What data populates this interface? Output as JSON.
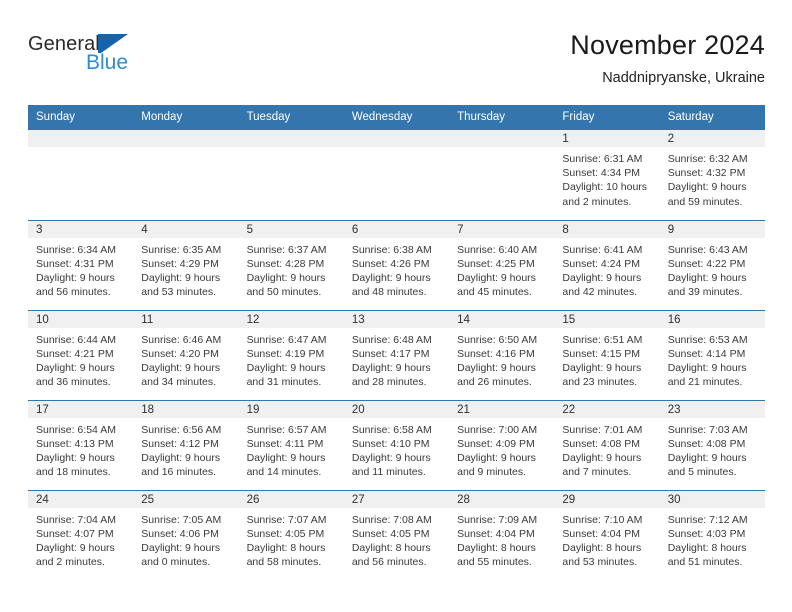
{
  "brand": {
    "name_part1": "General",
    "name_part2": "Blue",
    "logo_icon": "general-blue-triangle-logo",
    "accent_color": "#2e8bd6",
    "header_blue": "#3575ae"
  },
  "header": {
    "title": "November 2024",
    "location": "Naddnipryanske, Ukraine"
  },
  "calendar": {
    "weekday_headers": [
      "Sunday",
      "Monday",
      "Tuesday",
      "Wednesday",
      "Thursday",
      "Friday",
      "Saturday"
    ],
    "weeks": [
      [
        {
          "empty": true
        },
        {
          "empty": true
        },
        {
          "empty": true
        },
        {
          "empty": true
        },
        {
          "empty": true
        },
        {
          "day": "1",
          "sunrise": "Sunrise: 6:31 AM",
          "sunset": "Sunset: 4:34 PM",
          "daylight1": "Daylight: 10 hours",
          "daylight2": "and 2 minutes."
        },
        {
          "day": "2",
          "sunrise": "Sunrise: 6:32 AM",
          "sunset": "Sunset: 4:32 PM",
          "daylight1": "Daylight: 9 hours",
          "daylight2": "and 59 minutes."
        }
      ],
      [
        {
          "day": "3",
          "sunrise": "Sunrise: 6:34 AM",
          "sunset": "Sunset: 4:31 PM",
          "daylight1": "Daylight: 9 hours",
          "daylight2": "and 56 minutes."
        },
        {
          "day": "4",
          "sunrise": "Sunrise: 6:35 AM",
          "sunset": "Sunset: 4:29 PM",
          "daylight1": "Daylight: 9 hours",
          "daylight2": "and 53 minutes."
        },
        {
          "day": "5",
          "sunrise": "Sunrise: 6:37 AM",
          "sunset": "Sunset: 4:28 PM",
          "daylight1": "Daylight: 9 hours",
          "daylight2": "and 50 minutes."
        },
        {
          "day": "6",
          "sunrise": "Sunrise: 6:38 AM",
          "sunset": "Sunset: 4:26 PM",
          "daylight1": "Daylight: 9 hours",
          "daylight2": "and 48 minutes."
        },
        {
          "day": "7",
          "sunrise": "Sunrise: 6:40 AM",
          "sunset": "Sunset: 4:25 PM",
          "daylight1": "Daylight: 9 hours",
          "daylight2": "and 45 minutes."
        },
        {
          "day": "8",
          "sunrise": "Sunrise: 6:41 AM",
          "sunset": "Sunset: 4:24 PM",
          "daylight1": "Daylight: 9 hours",
          "daylight2": "and 42 minutes."
        },
        {
          "day": "9",
          "sunrise": "Sunrise: 6:43 AM",
          "sunset": "Sunset: 4:22 PM",
          "daylight1": "Daylight: 9 hours",
          "daylight2": "and 39 minutes."
        }
      ],
      [
        {
          "day": "10",
          "sunrise": "Sunrise: 6:44 AM",
          "sunset": "Sunset: 4:21 PM",
          "daylight1": "Daylight: 9 hours",
          "daylight2": "and 36 minutes."
        },
        {
          "day": "11",
          "sunrise": "Sunrise: 6:46 AM",
          "sunset": "Sunset: 4:20 PM",
          "daylight1": "Daylight: 9 hours",
          "daylight2": "and 34 minutes."
        },
        {
          "day": "12",
          "sunrise": "Sunrise: 6:47 AM",
          "sunset": "Sunset: 4:19 PM",
          "daylight1": "Daylight: 9 hours",
          "daylight2": "and 31 minutes."
        },
        {
          "day": "13",
          "sunrise": "Sunrise: 6:48 AM",
          "sunset": "Sunset: 4:17 PM",
          "daylight1": "Daylight: 9 hours",
          "daylight2": "and 28 minutes."
        },
        {
          "day": "14",
          "sunrise": "Sunrise: 6:50 AM",
          "sunset": "Sunset: 4:16 PM",
          "daylight1": "Daylight: 9 hours",
          "daylight2": "and 26 minutes."
        },
        {
          "day": "15",
          "sunrise": "Sunrise: 6:51 AM",
          "sunset": "Sunset: 4:15 PM",
          "daylight1": "Daylight: 9 hours",
          "daylight2": "and 23 minutes."
        },
        {
          "day": "16",
          "sunrise": "Sunrise: 6:53 AM",
          "sunset": "Sunset: 4:14 PM",
          "daylight1": "Daylight: 9 hours",
          "daylight2": "and 21 minutes."
        }
      ],
      [
        {
          "day": "17",
          "sunrise": "Sunrise: 6:54 AM",
          "sunset": "Sunset: 4:13 PM",
          "daylight1": "Daylight: 9 hours",
          "daylight2": "and 18 minutes."
        },
        {
          "day": "18",
          "sunrise": "Sunrise: 6:56 AM",
          "sunset": "Sunset: 4:12 PM",
          "daylight1": "Daylight: 9 hours",
          "daylight2": "and 16 minutes."
        },
        {
          "day": "19",
          "sunrise": "Sunrise: 6:57 AM",
          "sunset": "Sunset: 4:11 PM",
          "daylight1": "Daylight: 9 hours",
          "daylight2": "and 14 minutes."
        },
        {
          "day": "20",
          "sunrise": "Sunrise: 6:58 AM",
          "sunset": "Sunset: 4:10 PM",
          "daylight1": "Daylight: 9 hours",
          "daylight2": "and 11 minutes."
        },
        {
          "day": "21",
          "sunrise": "Sunrise: 7:00 AM",
          "sunset": "Sunset: 4:09 PM",
          "daylight1": "Daylight: 9 hours",
          "daylight2": "and 9 minutes."
        },
        {
          "day": "22",
          "sunrise": "Sunrise: 7:01 AM",
          "sunset": "Sunset: 4:08 PM",
          "daylight1": "Daylight: 9 hours",
          "daylight2": "and 7 minutes."
        },
        {
          "day": "23",
          "sunrise": "Sunrise: 7:03 AM",
          "sunset": "Sunset: 4:08 PM",
          "daylight1": "Daylight: 9 hours",
          "daylight2": "and 5 minutes."
        }
      ],
      [
        {
          "day": "24",
          "sunrise": "Sunrise: 7:04 AM",
          "sunset": "Sunset: 4:07 PM",
          "daylight1": "Daylight: 9 hours",
          "daylight2": "and 2 minutes."
        },
        {
          "day": "25",
          "sunrise": "Sunrise: 7:05 AM",
          "sunset": "Sunset: 4:06 PM",
          "daylight1": "Daylight: 9 hours",
          "daylight2": "and 0 minutes."
        },
        {
          "day": "26",
          "sunrise": "Sunrise: 7:07 AM",
          "sunset": "Sunset: 4:05 PM",
          "daylight1": "Daylight: 8 hours",
          "daylight2": "and 58 minutes."
        },
        {
          "day": "27",
          "sunrise": "Sunrise: 7:08 AM",
          "sunset": "Sunset: 4:05 PM",
          "daylight1": "Daylight: 8 hours",
          "daylight2": "and 56 minutes."
        },
        {
          "day": "28",
          "sunrise": "Sunrise: 7:09 AM",
          "sunset": "Sunset: 4:04 PM",
          "daylight1": "Daylight: 8 hours",
          "daylight2": "and 55 minutes."
        },
        {
          "day": "29",
          "sunrise": "Sunrise: 7:10 AM",
          "sunset": "Sunset: 4:04 PM",
          "daylight1": "Daylight: 8 hours",
          "daylight2": "and 53 minutes."
        },
        {
          "day": "30",
          "sunrise": "Sunrise: 7:12 AM",
          "sunset": "Sunset: 4:03 PM",
          "daylight1": "Daylight: 8 hours",
          "daylight2": "and 51 minutes."
        }
      ]
    ]
  }
}
